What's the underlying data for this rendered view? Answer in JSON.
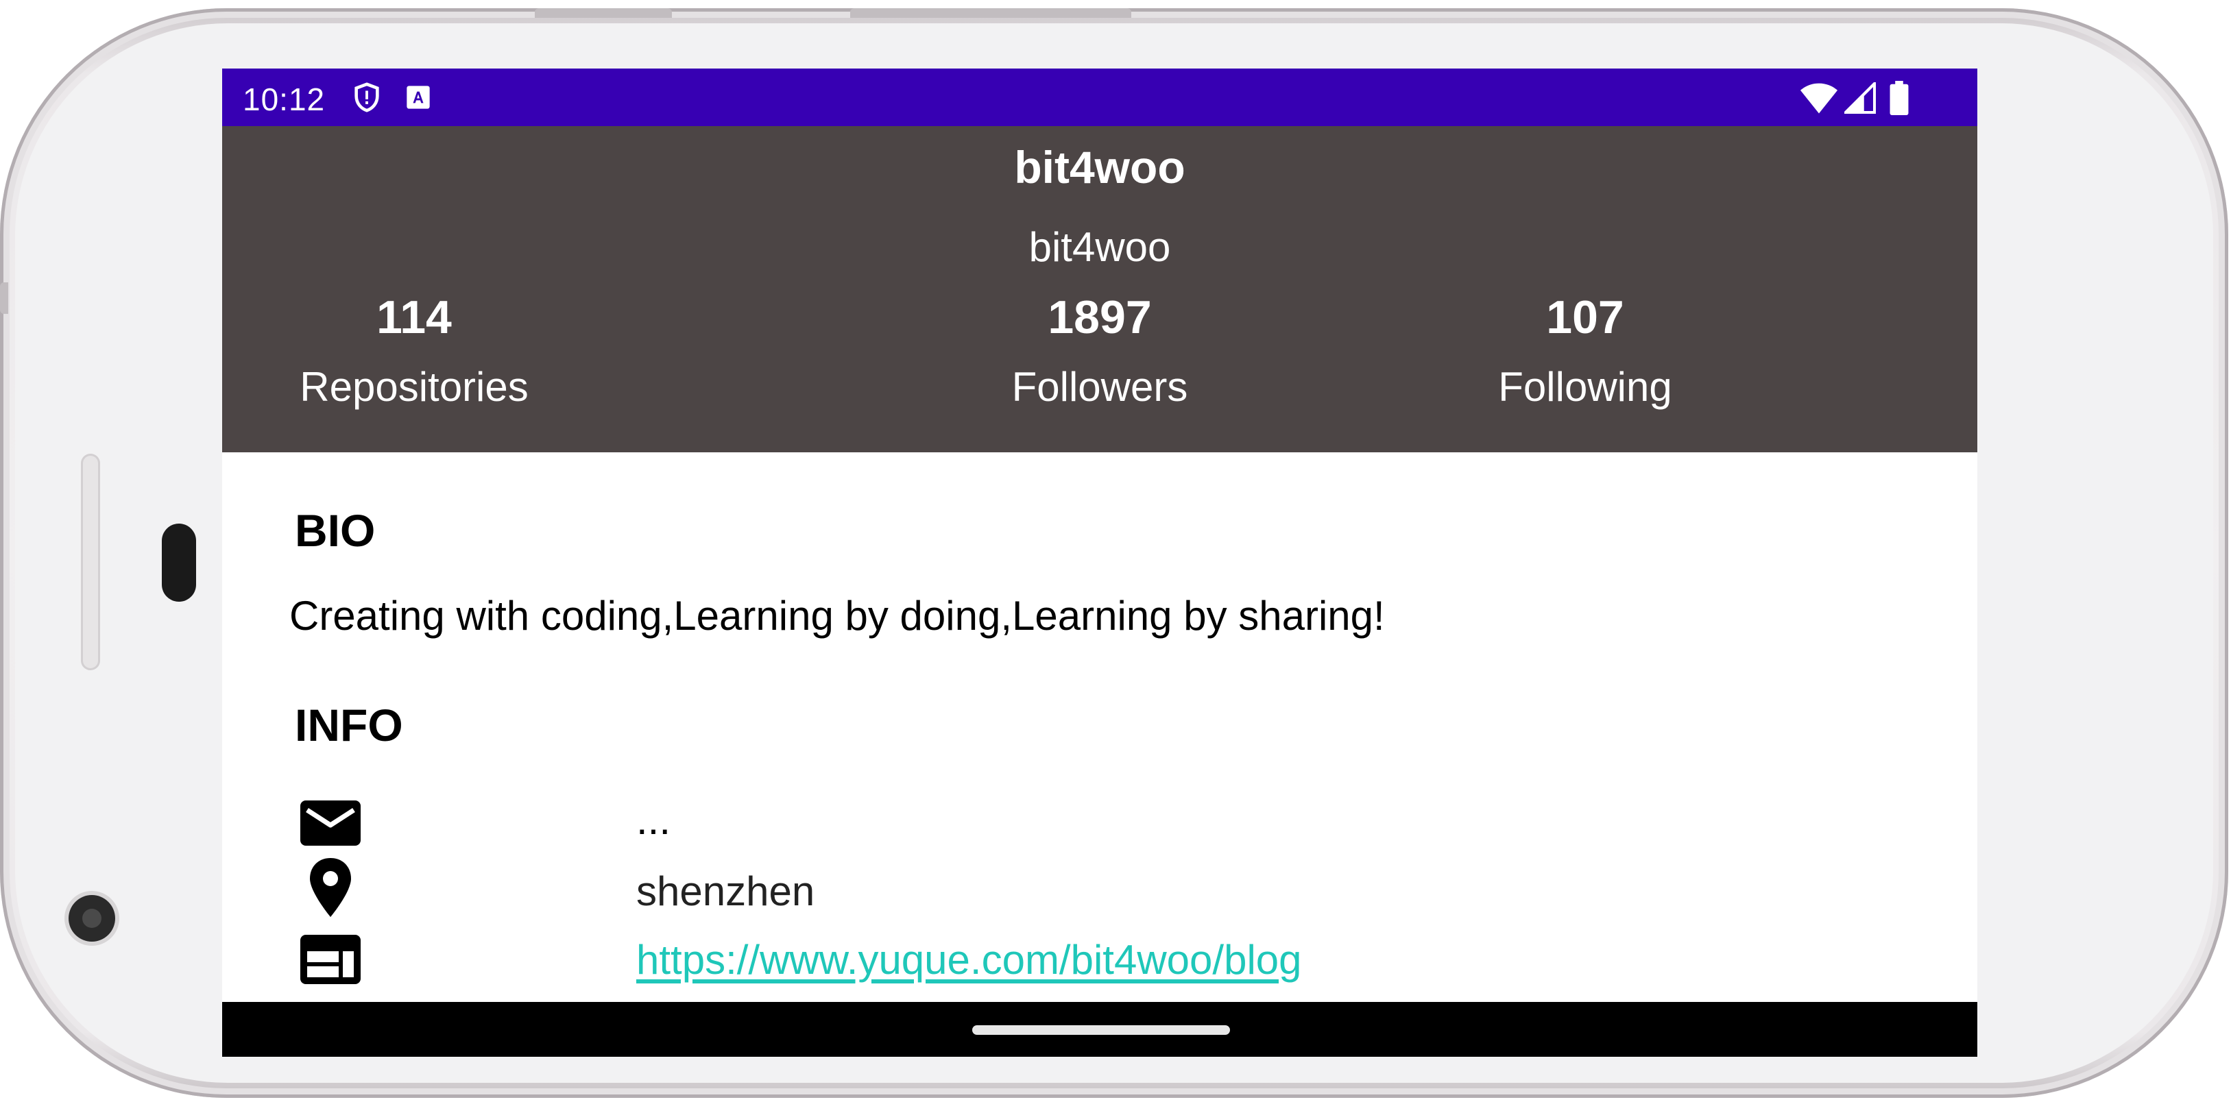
{
  "status_bar": {
    "time": "10:12",
    "icons": [
      "shield-alert-icon",
      "a-notification-icon",
      "wifi-icon",
      "cell-signal-icon",
      "battery-icon"
    ],
    "color": "#3700b3"
  },
  "profile": {
    "name": "bit4woo",
    "login": "bit4woo",
    "header_color": "#4c4545",
    "stats": [
      {
        "value": "114",
        "label": "Repositories"
      },
      {
        "value": "1897",
        "label": "Followers"
      },
      {
        "value": "107",
        "label": "Following"
      }
    ]
  },
  "bio": {
    "title": "BIO",
    "text": "Creating with coding,Learning by doing,Learning by sharing!"
  },
  "info": {
    "title": "INFO",
    "email": {
      "icon": "mail-icon",
      "value": "..."
    },
    "location": {
      "icon": "location-pin-icon",
      "value": "shenzhen"
    },
    "blog": {
      "icon": "web-icon",
      "value": "https://www.yuque.com/bit4woo/blog",
      "color": "#1fc7b9"
    }
  }
}
